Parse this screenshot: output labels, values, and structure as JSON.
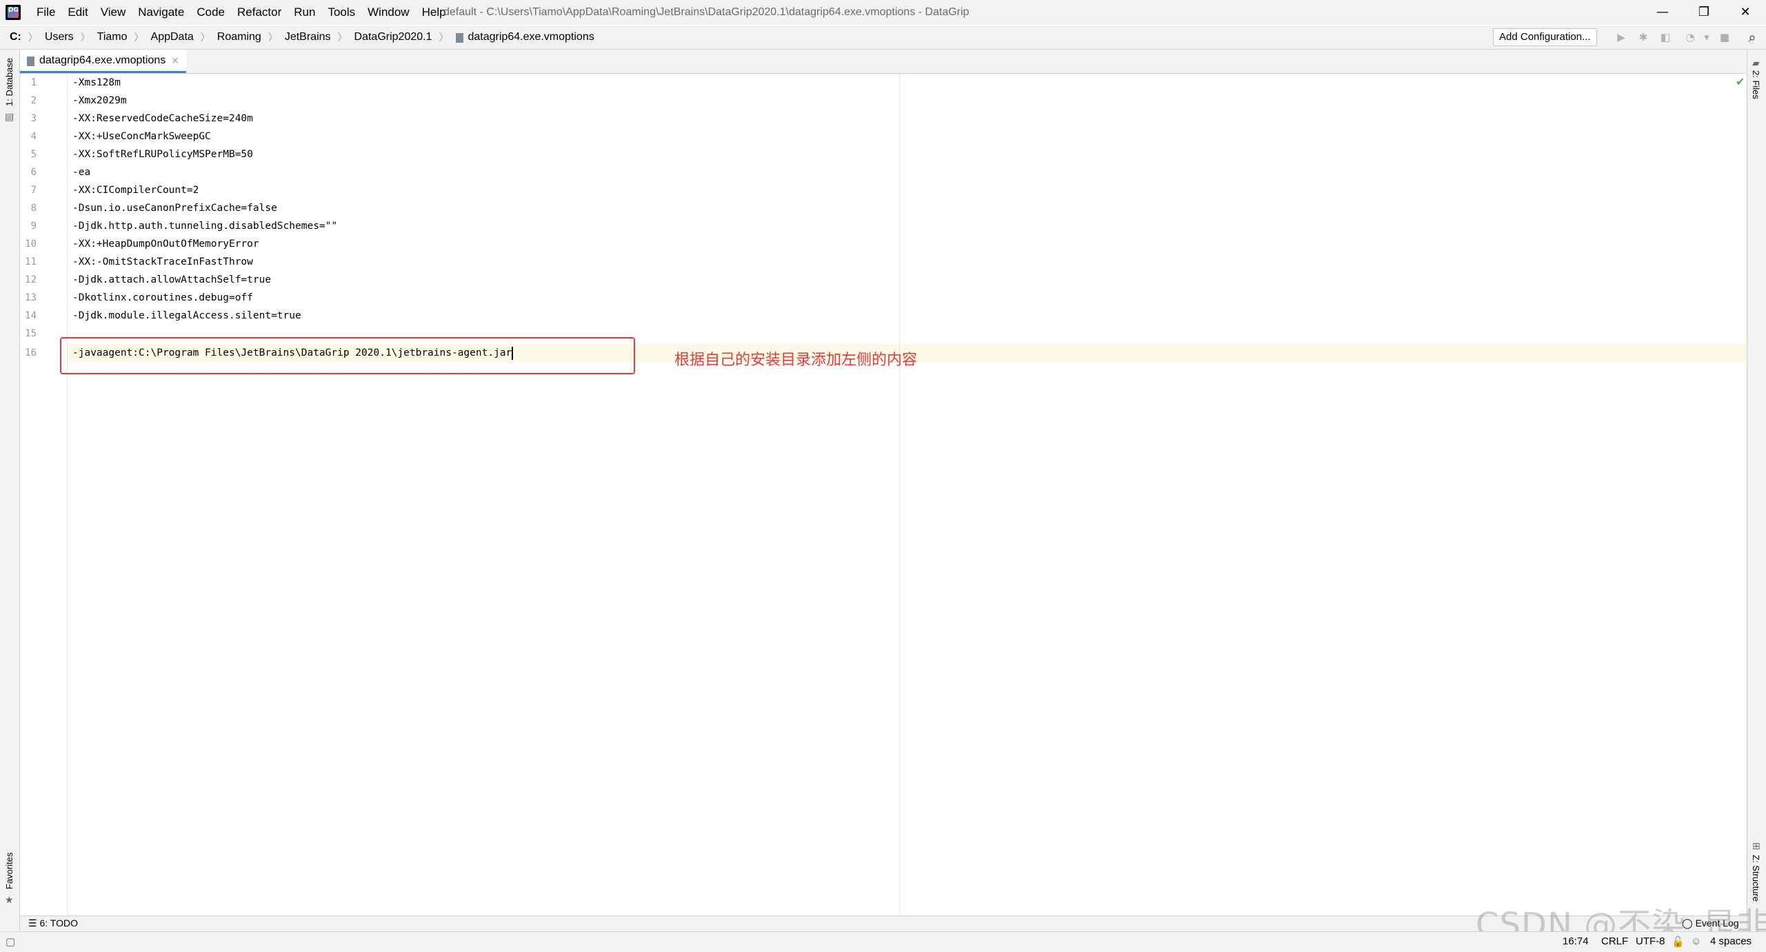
{
  "titlebar": {
    "logo_text": "DG",
    "menu": [
      "File",
      "Edit",
      "View",
      "Navigate",
      "Code",
      "Refactor",
      "Run",
      "Tools",
      "Window",
      "Help"
    ],
    "window_title": "default - C:\\Users\\Tiamo\\AppData\\Roaming\\JetBrains\\DataGrip2020.1\\datagrip64.exe.vmoptions - DataGrip",
    "minimize": "—",
    "restore": "❐",
    "close": "✕"
  },
  "navbar": {
    "crumbs": [
      "C:",
      "Users",
      "Tiamo",
      "AppData",
      "Roaming",
      "JetBrains",
      "DataGrip2020.1",
      "datagrip64.exe.vmoptions"
    ],
    "add_configuration": "Add Configuration...",
    "search_icon": "⌕"
  },
  "left_stripe": {
    "database": "1: Database",
    "favorites": "Favorites"
  },
  "right_stripe": {
    "files": "2: Files",
    "structure": "Z: Structure"
  },
  "tab": {
    "label": "datagrip64.exe.vmoptions",
    "close": "×"
  },
  "editor": {
    "lines": [
      "-Xms128m",
      "-Xmx2029m",
      "-XX:ReservedCodeCacheSize=240m",
      "-XX:+UseConcMarkSweepGC",
      "-XX:SoftRefLRUPolicyMSPerMB=50",
      "-ea",
      "-XX:CICompilerCount=2",
      "-Dsun.io.useCanonPrefixCache=false",
      "-Djdk.http.auth.tunneling.disabledSchemes=\"\"",
      "-XX:+HeapDumpOnOutOfMemoryError",
      "-XX:-OmitStackTraceInFastThrow",
      "-Djdk.attach.allowAttachSelf=true",
      "-Dkotlinx.coroutines.debug=off",
      "-Djdk.module.illegalAccess.silent=true",
      "",
      "-javaagent:C:\\Program Files\\JetBrains\\DataGrip 2020.1\\jetbrains-agent.jar"
    ],
    "annotation": "根据自己的安装目录添加左侧的内容",
    "check": "✔"
  },
  "toolwindows": {
    "todo": "6: TODO",
    "event_log": "Event Log"
  },
  "statusbar": {
    "position": "16:74",
    "line_sep": "CRLF",
    "encoding": "UTF-8",
    "indent": "4 spaces"
  },
  "watermark": "CSDN @不染_是非"
}
